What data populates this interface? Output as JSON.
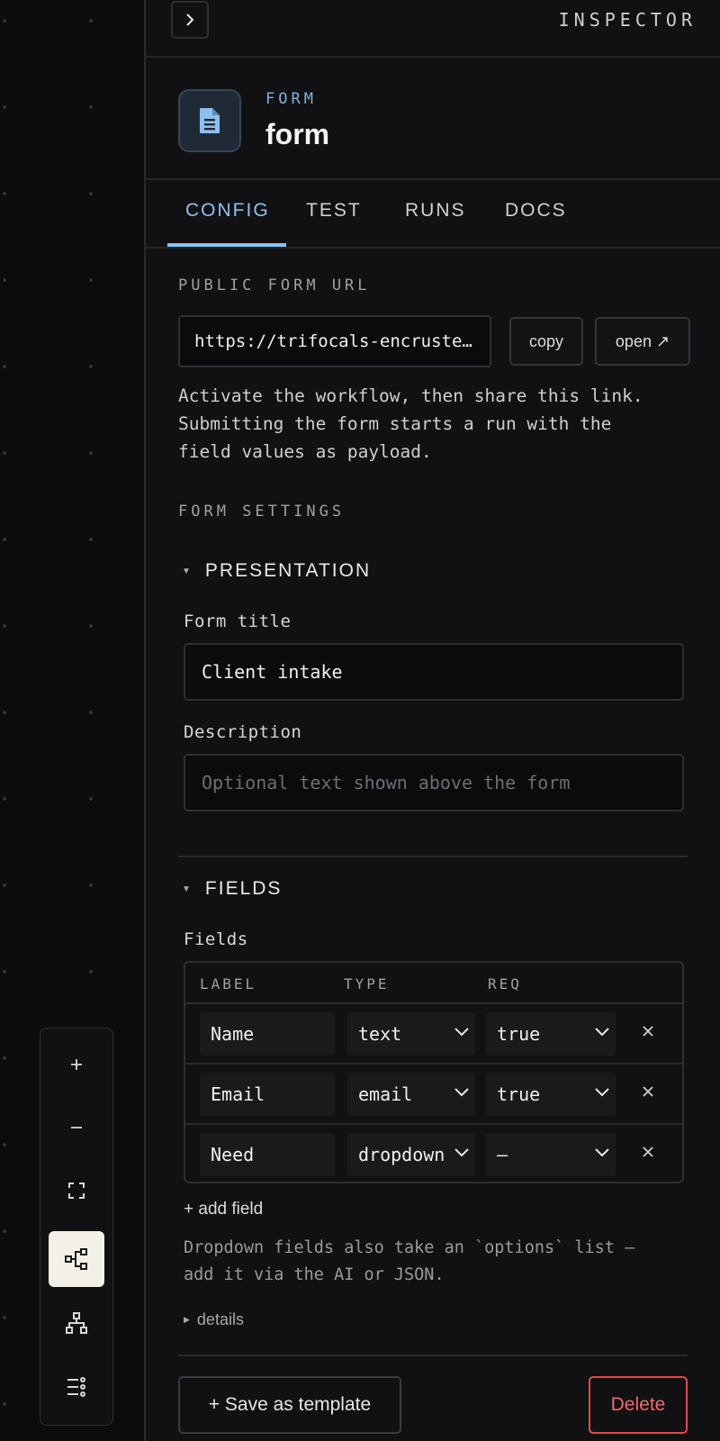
{
  "inspector": {
    "title": "INSPECTOR"
  },
  "node": {
    "kind": "FORM",
    "name": "form"
  },
  "tabs": [
    {
      "label": "CONFIG",
      "active": true
    },
    {
      "label": "TEST",
      "active": false
    },
    {
      "label": "RUNS",
      "active": false
    },
    {
      "label": "DOCS",
      "active": false
    }
  ],
  "public_url": {
    "section_label": "PUBLIC FORM URL",
    "value": "https://trifocals-encrusted.example/form",
    "copy_label": "copy",
    "open_label": "open ↗",
    "hint_lines": [
      "Activate the workflow, then share this link.",
      "Submitting the form starts a run with the",
      "field values as payload."
    ]
  },
  "form_settings": {
    "section_label": "FORM SETTINGS"
  },
  "presentation": {
    "heading": "PRESENTATION",
    "title_label": "Form title",
    "title_value": "Client intake",
    "description_label": "Description",
    "description_placeholder": "Optional text shown above the form"
  },
  "fields": {
    "heading": "FIELDS",
    "label": "Fields",
    "columns": [
      "LABEL",
      "TYPE",
      "REQ"
    ],
    "rows": [
      {
        "label": "Name",
        "type": "text",
        "req": "true"
      },
      {
        "label": "Email",
        "type": "email",
        "req": "true"
      },
      {
        "label": "Need",
        "type": "dropdown",
        "req": "—"
      }
    ],
    "add_label": "+ add field",
    "hint_lines": [
      "Dropdown fields also take an `options` list —",
      "add it via the AI or JSON."
    ],
    "details_label": "details"
  },
  "footer": {
    "save_template_label": "+ Save as template",
    "delete_label": "Delete"
  },
  "colors": {
    "accent": "#8cc0ee",
    "danger": "#e5484d",
    "background": "#111113"
  }
}
